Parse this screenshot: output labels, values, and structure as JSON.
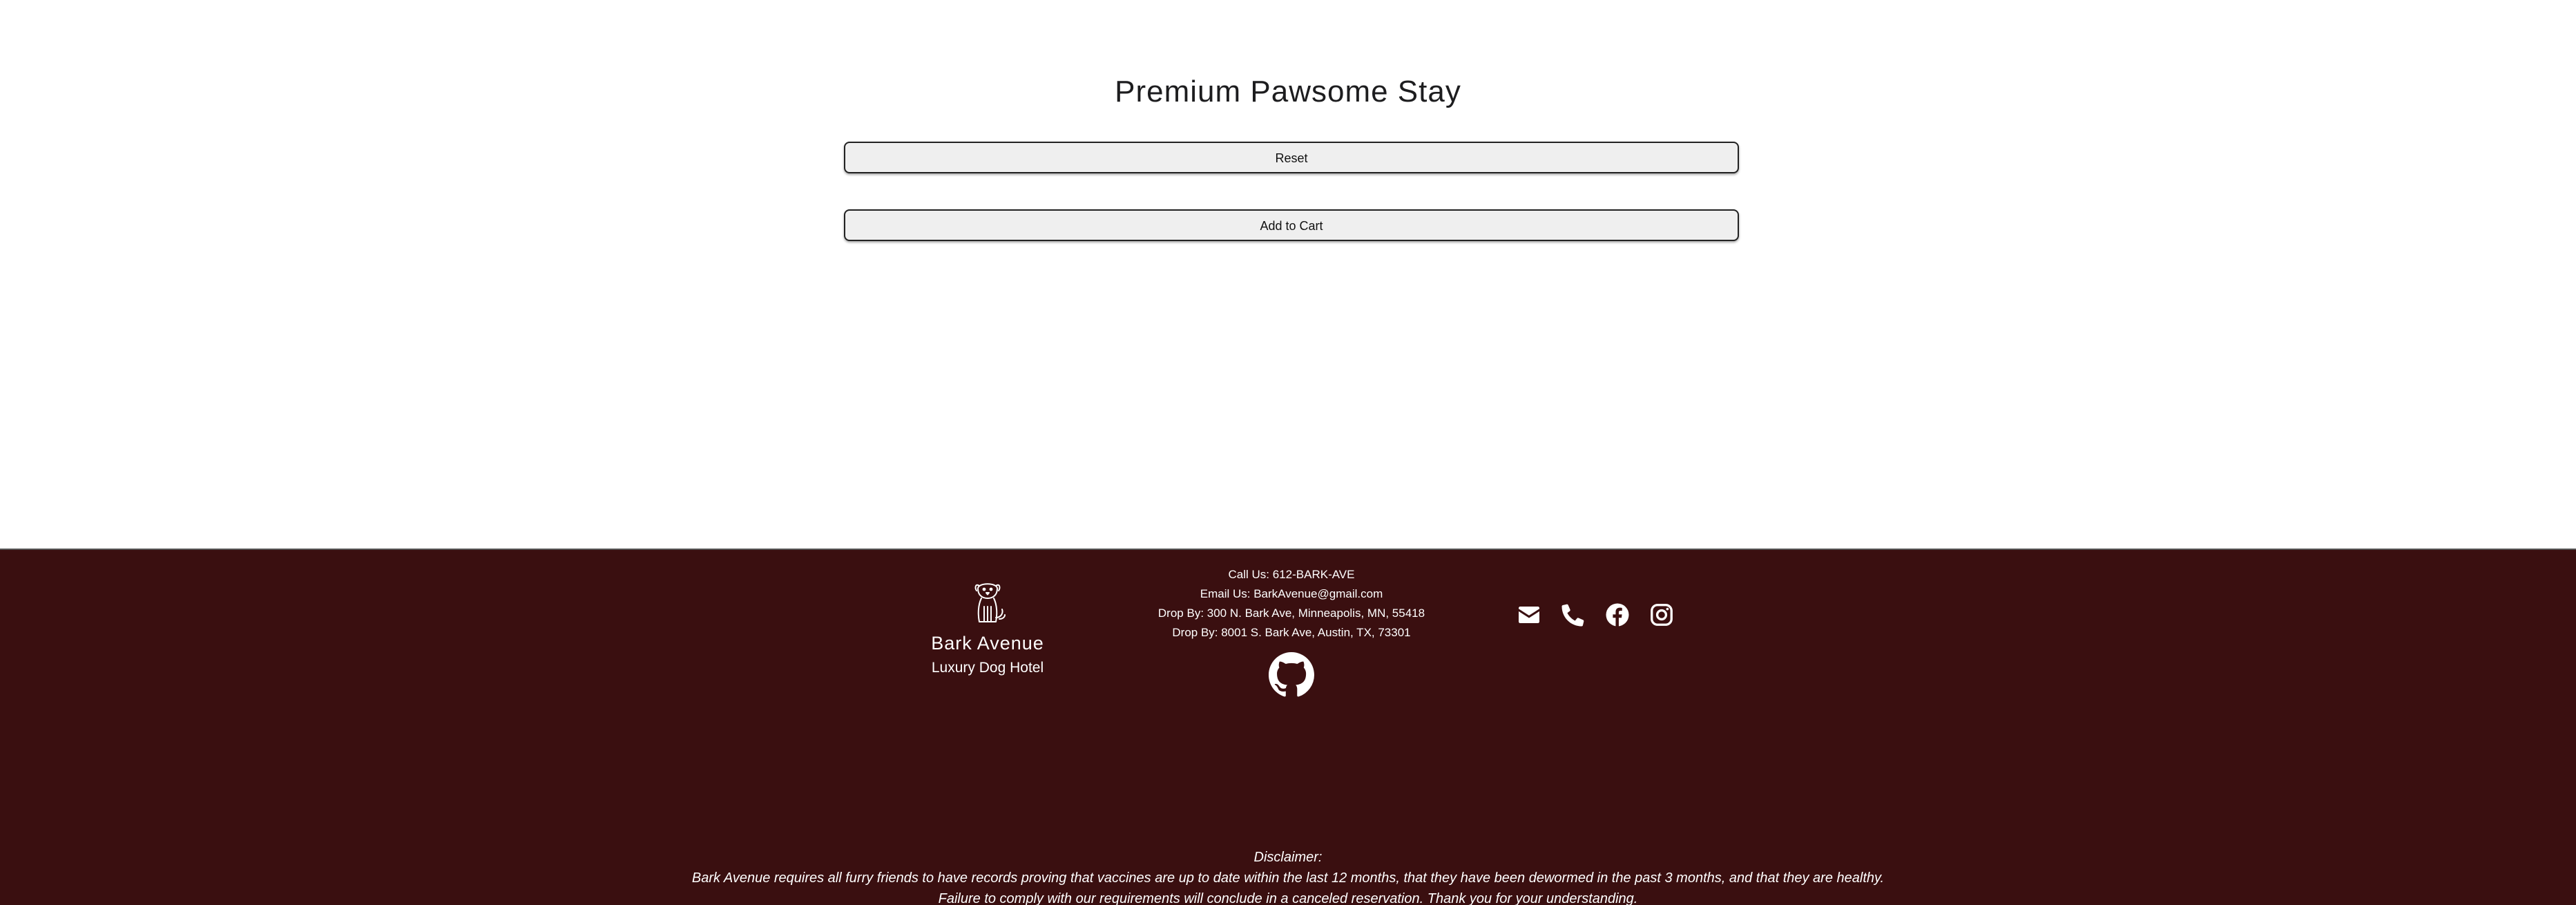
{
  "product": {
    "title": "Premium Pawsome Stay",
    "reset_label": "Reset",
    "add_to_cart_label": "Add to Cart"
  },
  "footer": {
    "brand_name": "Bark Avenue",
    "brand_tagline": "Luxury Dog Hotel",
    "logo_icon": "dog-logo-icon",
    "contact": {
      "call": "Call Us: 612-BARK-AVE",
      "email": "Email Us: BarkAvenue@gmail.com",
      "address1": "Drop By: 300 N. Bark Ave, Minneapolis, MN, 55418",
      "address2": "Drop By: 8001 S. Bark Ave, Austin, TX, 73301"
    },
    "github_icon": "github-icon",
    "social_icons": [
      "envelope-icon",
      "phone-icon",
      "facebook-icon",
      "instagram-icon"
    ],
    "disclaimer": {
      "heading": "Disclaimer:",
      "line1": "Bark Avenue requires all furry friends to have records proving that vaccines are up to date within the last 12 months, that they have been dewormed in the past 3 months, and that they are healthy.",
      "line2": "Failure to comply with our requirements will conclude in a canceled reservation. Thank you for your understanding."
    }
  },
  "colors": {
    "footer_bg": "#3a0f10",
    "button_bg": "#efefef",
    "text_dark": "#1d1d1f",
    "text_light": "#ffffff"
  }
}
